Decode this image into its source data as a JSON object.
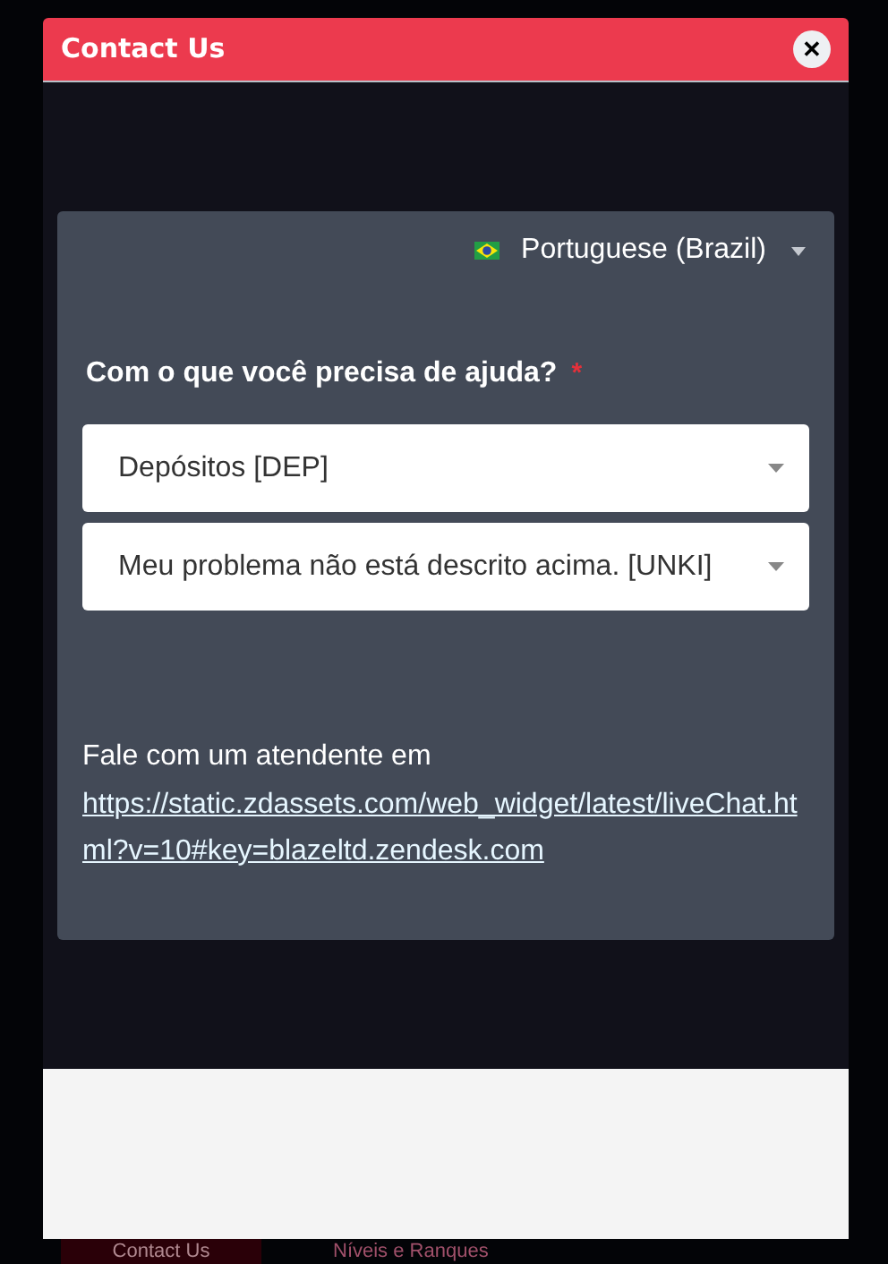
{
  "modal": {
    "title": "Contact Us",
    "close": "✕"
  },
  "language": {
    "label": "Portuguese (Brazil)"
  },
  "form": {
    "question": "Com o que você precisa de ajuda?",
    "required_mark": "*",
    "selects": [
      {
        "value": "Depósitos [DEP]"
      },
      {
        "value": "Meu problema não está descrito acima. [UNKI]"
      }
    ],
    "message": "Fale com um atendente em",
    "link": "https://static.zdassets.com/web_widget/latest/liveChat.html?v=10#key=blazeltd.zendesk.com"
  },
  "background": {
    "button": "Contact Us",
    "link": "Níveis e Ranques"
  }
}
